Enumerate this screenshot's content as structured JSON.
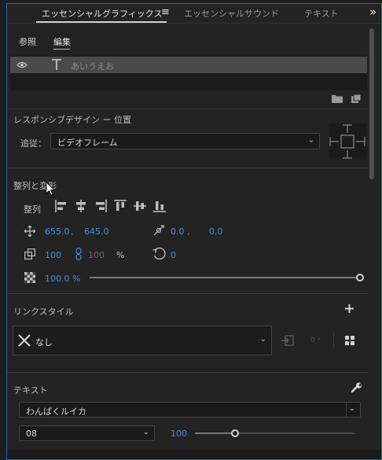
{
  "tabs": [
    {
      "label": "エッセンシャルグラフィックス",
      "active": true
    },
    {
      "label": "エッセンシャルサウンド",
      "active": false
    },
    {
      "label": "テキスト",
      "active": false
    }
  ],
  "menu_icon": "≡",
  "overflow_icon": "»",
  "subtabs": [
    {
      "label": "参照"
    },
    {
      "label": "編集"
    }
  ],
  "layer": {
    "name": "あいうえお"
  },
  "responsive": {
    "title": "レスポンシブデザイン ー 位置",
    "follow_label": "追従：",
    "follow_value": "ビデオフレーム"
  },
  "align": {
    "section_title": "整列と変形",
    "align_label": "整列",
    "position_x": "655.0",
    "position_sep": ",",
    "position_y": "645.0",
    "anchor_x": "0.0",
    "anchor_sep": ",",
    "anchor_y": "0.0",
    "scale_w": "100",
    "scale_h": "100",
    "scale_unit": "%",
    "rotation": "0",
    "opacity": "100.0 %",
    "opacity_level": 1.0
  },
  "link_style": {
    "title": "リンクスタイル",
    "value": "なし",
    "small_value": "0"
  },
  "text_section": {
    "title": "テキスト",
    "font": "わんぱくルイカ",
    "style": "08",
    "size": "100",
    "size_slider_level": 0.25
  },
  "colors": {
    "accent_blue": "#3f8fe0",
    "frame_border": "#2f5fb8",
    "panel_bg": "#232323",
    "layer_row_bg": "#4a4a4a"
  }
}
